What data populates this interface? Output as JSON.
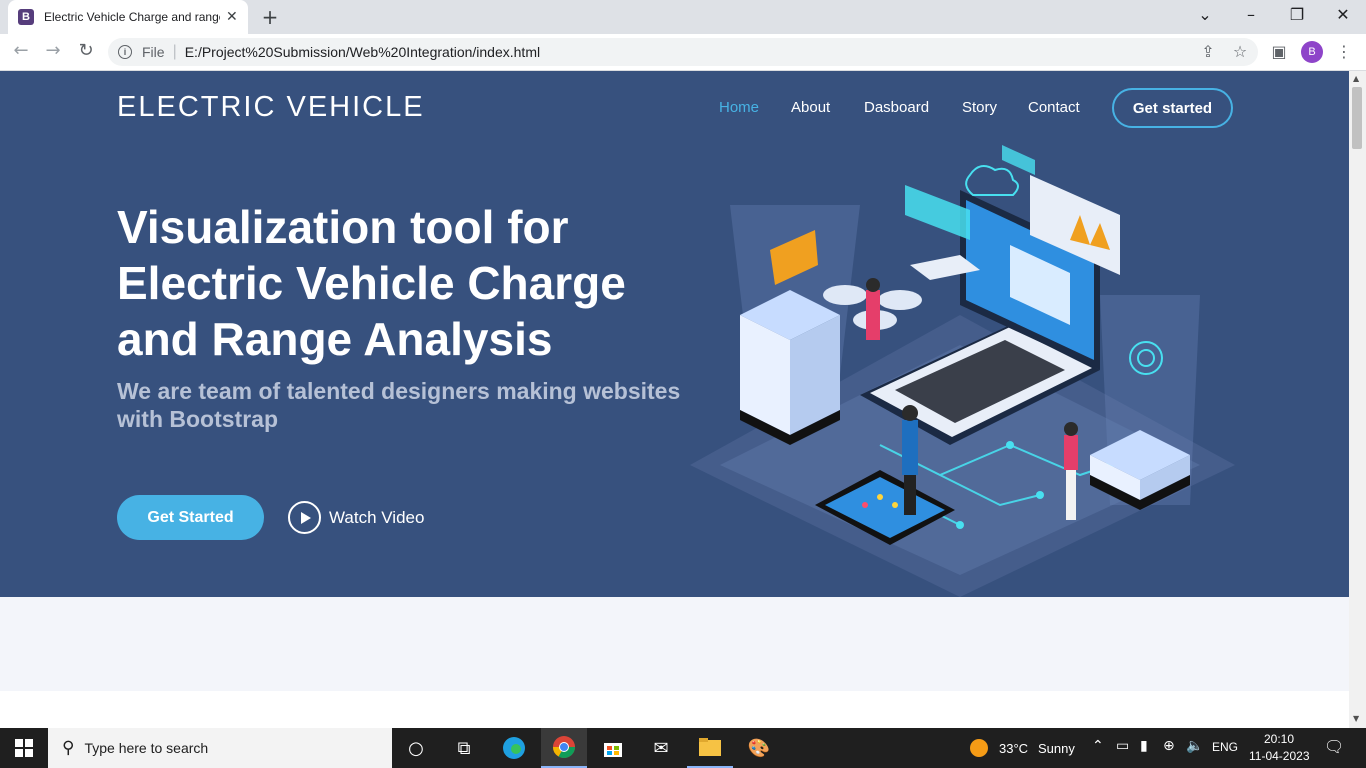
{
  "browser": {
    "tab_title": "Electric Vehicle Charge and range",
    "tab_favicon": "B",
    "url_scheme": "File",
    "url": "E:/Project%20Submission/Web%20Integration/index.html",
    "profile_initial": "B"
  },
  "page": {
    "logo": "ELECTRIC VEHICLE",
    "nav": [
      "Home",
      "About",
      "Dasboard",
      "Story",
      "Contact"
    ],
    "nav_cta": "Get started",
    "hero_title": "Visualization tool for Electric Vehicle Charge and Range Analysis",
    "hero_subtitle": "We are team of talented designers making websites with Bootstrap",
    "primary_button": "Get Started",
    "watch_video": "Watch Video"
  },
  "taskbar": {
    "search_placeholder": "Type here to search",
    "weather_temp": "33°C",
    "weather_text": "Sunny",
    "language": "ENG",
    "time": "20:10",
    "date": "11-04-2023"
  },
  "colors": {
    "hero_bg": "#37517e",
    "accent": "#47b2e4",
    "band_bg": "#f3f5fa"
  }
}
